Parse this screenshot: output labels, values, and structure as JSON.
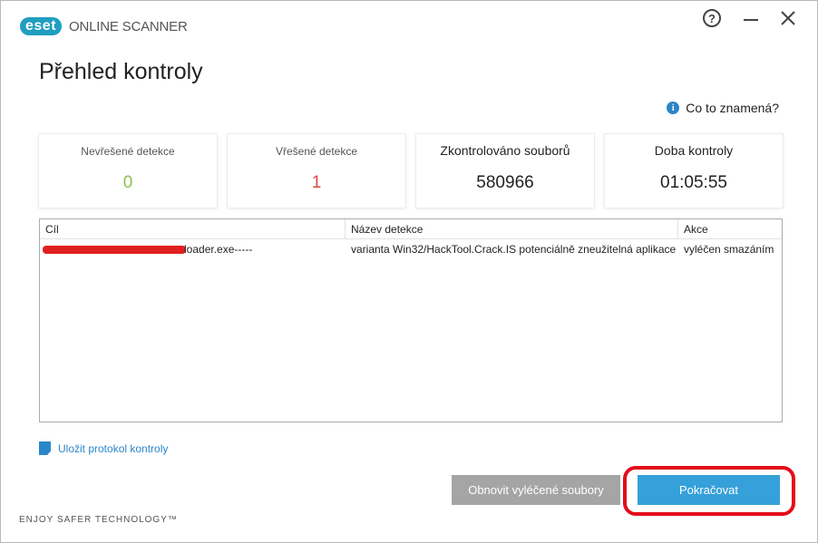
{
  "app": {
    "logo_badge": "eset",
    "logo_text": "ONLINE SCANNER",
    "help_glyph": "?",
    "minimize_glyph": "—",
    "close_glyph": "✕"
  },
  "page": {
    "title": "Přehled kontroly",
    "info_link": "Co to znamená?"
  },
  "cards": [
    {
      "label": "Nevřešené detekce",
      "value": "0",
      "color": "#8ec04f"
    },
    {
      "label": "Vřešené detekce",
      "value": "1",
      "color": "#e0493e"
    },
    {
      "label": "Zkontrolováno souborů",
      "value": "580966",
      "color": "#222222"
    },
    {
      "label": "Doba kontroly",
      "value": "01:05:55",
      "color": "#222222"
    }
  ],
  "table": {
    "headers": {
      "target": "Cíl",
      "name": "Název detekce",
      "action": "Akce"
    },
    "rows": [
      {
        "target_prefix": "",
        "target_suffix": "loader.exe-----",
        "name": "varianta Win32/HackTool.Crack.IS potenciálně zneužitelná aplikace",
        "action": "vyléčen smazáním"
      }
    ]
  },
  "footer_actions": {
    "save_log": "Uložit protokol kontroly",
    "restore_button": "Obnovit vyléčené soubory",
    "continue_button": "Pokračovat"
  },
  "footer": {
    "tagline": "ENJOY SAFER TECHNOLOGY™"
  },
  "colors": {
    "accent": "#35a0d9",
    "link": "#2a86c8",
    "highlight": "#e30c1a"
  },
  "icons": [
    "help-icon",
    "minimize-icon",
    "close-icon",
    "info-icon",
    "save-icon"
  ]
}
